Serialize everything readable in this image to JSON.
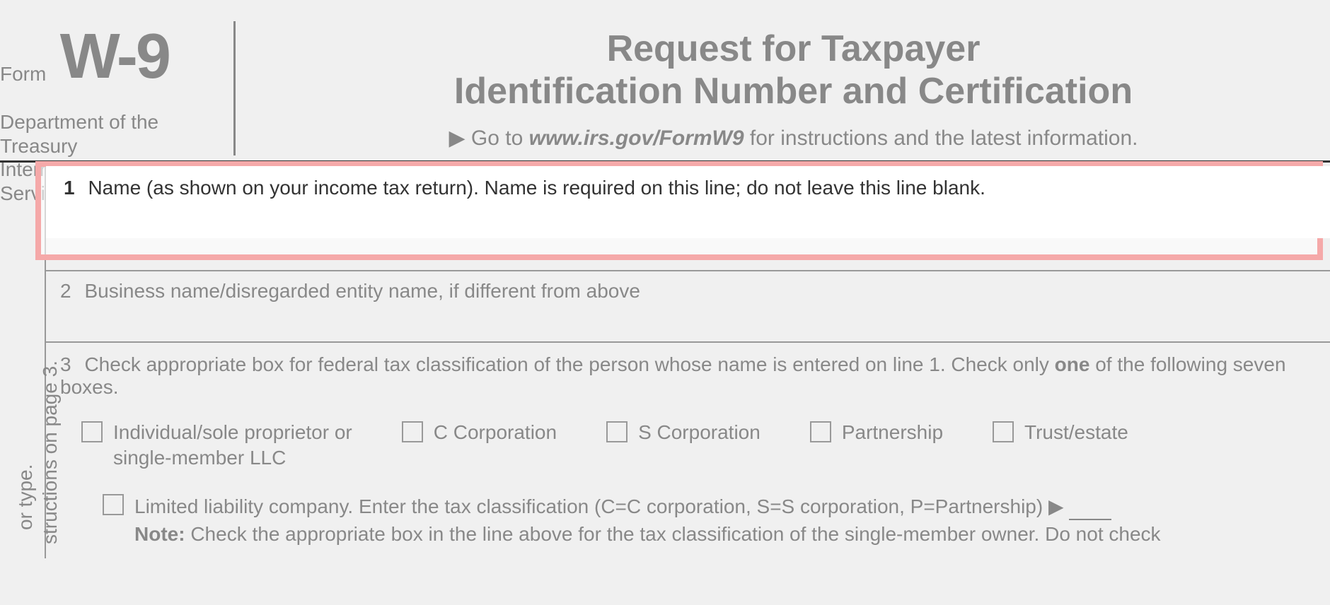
{
  "header": {
    "form_label": "Form",
    "form_code": "W-9",
    "dept_line1": "Department of the Treasury",
    "dept_line2": "Internal Revenue Service",
    "title_line1": "Request for Taxpayer",
    "title_line2": "Identification Number and Certification",
    "link_prefix": "▶ Go to ",
    "link_url": "www.irs.gov/FormW9",
    "link_suffix": " for instructions and the latest information."
  },
  "margin": {
    "rotated1": "or type.",
    "rotated2": "structions on page 3."
  },
  "lines": {
    "l1_num": "1",
    "l1_text": "Name (as shown on your income tax return). Name is required on this line; do not leave this line blank.",
    "l2_num": "2",
    "l2_text": "Business name/disregarded entity name, if different from above",
    "l3_num": "3",
    "l3_text_a": "Check appropriate box for federal tax classification of the person whose name is entered on line 1. Check only ",
    "l3_one": "one",
    "l3_text_b": " of the following seven boxes."
  },
  "checkboxes": {
    "individual_l1": "Individual/sole proprietor or",
    "individual_l2": "single-member LLC",
    "c_corp": "C Corporation",
    "s_corp": "S Corporation",
    "partnership": "Partnership",
    "trust": "Trust/estate",
    "llc_text": "Limited liability company. Enter the tax classification (C=C corporation, S=S corporation, P=Partnership) ▶",
    "note_label": "Note:",
    "note_text": " Check the appropriate box in the line above for the tax classification of the single-member owner.  Do not check"
  }
}
